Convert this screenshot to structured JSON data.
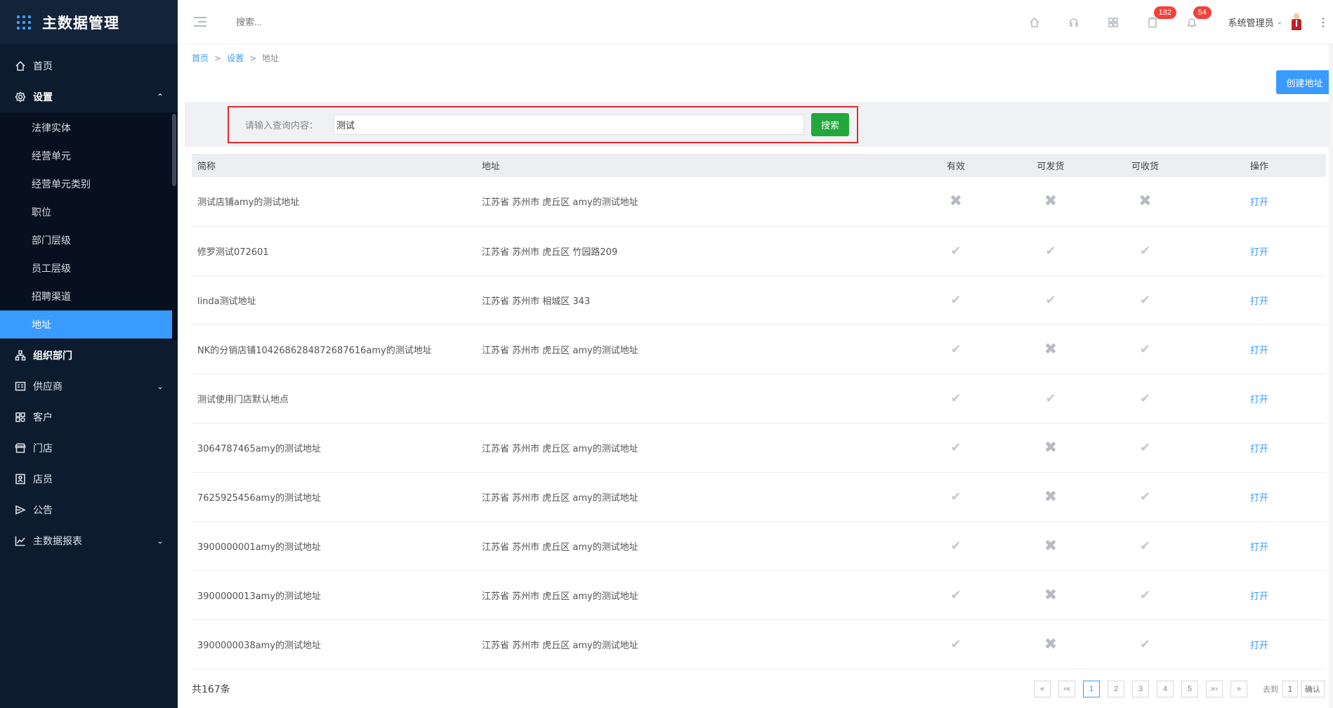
{
  "app": {
    "title": "主数据管理"
  },
  "sidebar": {
    "items": [
      {
        "label": "首页",
        "icon": "home-icon"
      },
      {
        "label": "设置",
        "icon": "gear-icon",
        "caret": "⌃"
      },
      {
        "label": "组织部门",
        "icon": "org-icon"
      },
      {
        "label": "供应商",
        "icon": "supplier-icon",
        "caret": "⌄"
      },
      {
        "label": "客户",
        "icon": "customer-icon"
      },
      {
        "label": "门店",
        "icon": "store-icon"
      },
      {
        "label": "店员",
        "icon": "clerk-icon"
      },
      {
        "label": "公告",
        "icon": "announcement-icon"
      },
      {
        "label": "主数据报表",
        "icon": "report-icon",
        "caret": "⌄"
      }
    ],
    "settings_sub": [
      "法律实体",
      "经营单元",
      "经营单元类别",
      "职位",
      "部门层级",
      "员工层级",
      "招聘渠道",
      "地址"
    ],
    "active_sub": "地址"
  },
  "topbar": {
    "search_placeholder": "搜索...",
    "badges": {
      "tasks": "182",
      "notifications": "54"
    },
    "user_name": "系统管理员",
    "more": "⋮"
  },
  "breadcrumb": {
    "home": "首页",
    "settings": "设置",
    "current": "地址",
    "sep": ">"
  },
  "actions": {
    "create_label": "创建地址"
  },
  "search": {
    "label": "请输入查询内容：",
    "value": "测试",
    "button": "搜索"
  },
  "table": {
    "headers": {
      "name": "简称",
      "address": "地址",
      "valid": "有效",
      "ship": "可发货",
      "receive": "可收货",
      "op": "操作"
    },
    "open_label": "打开",
    "rows": [
      {
        "name": "测试店铺amy的测试地址",
        "address": "江苏省 苏州市 虎丘区 amy的测试地址",
        "valid": false,
        "ship": false,
        "receive": false
      },
      {
        "name": "修罗测试072601",
        "address": "江苏省 苏州市 虎丘区 竹园路209",
        "valid": true,
        "ship": true,
        "receive": true
      },
      {
        "name": "linda测试地址",
        "address": "江苏省 苏州市 相城区 343",
        "valid": true,
        "ship": true,
        "receive": true
      },
      {
        "name": "NK的分销店铺1042686284872687616amy的测试地址",
        "address": "江苏省 苏州市 虎丘区 amy的测试地址",
        "valid": true,
        "ship": false,
        "receive": true
      },
      {
        "name": "测试使用门店默认地点",
        "address": "",
        "valid": true,
        "ship": true,
        "receive": true
      },
      {
        "name": "3064787465amy的测试地址",
        "address": "江苏省 苏州市 虎丘区 amy的测试地址",
        "valid": true,
        "ship": false,
        "receive": true
      },
      {
        "name": "7625925456amy的测试地址",
        "address": "江苏省 苏州市 虎丘区 amy的测试地址",
        "valid": true,
        "ship": false,
        "receive": true
      },
      {
        "name": "3900000001amy的测试地址",
        "address": "江苏省 苏州市 虎丘区 amy的测试地址",
        "valid": true,
        "ship": false,
        "receive": true
      },
      {
        "name": "3900000013amy的测试地址",
        "address": "江苏省 苏州市 虎丘区 amy的测试地址",
        "valid": true,
        "ship": false,
        "receive": true
      },
      {
        "name": "3900000038amy的测试地址",
        "address": "江苏省 苏州市 虎丘区 amy的测试地址",
        "valid": true,
        "ship": false,
        "receive": true
      }
    ]
  },
  "pagination": {
    "total": "共167条",
    "first": "«",
    "prev": "‹«",
    "next": "»›",
    "last": "»",
    "pages": [
      "1",
      "2",
      "3",
      "4",
      "5"
    ],
    "current": "1",
    "goto_label": "去到",
    "goto_value": "1",
    "confirm": "确认"
  },
  "colors": {
    "accent": "#3a9bff",
    "search_button": "#22a73d",
    "sidebar_bg": "#0d1b2e",
    "highlight_border": "#e52b2b",
    "badge": "#f0433b"
  }
}
